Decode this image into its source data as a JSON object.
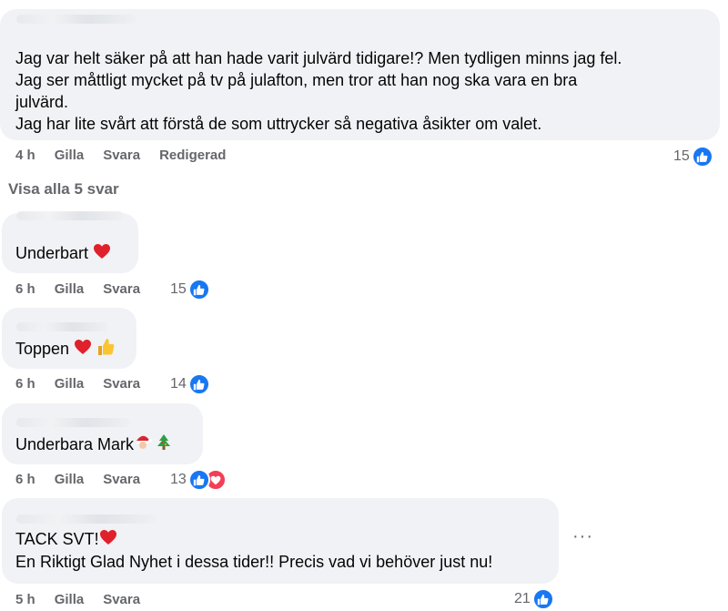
{
  "top_comment": {
    "lines": [
      "Jag var helt säker på att han hade varit julvärd tidigare!? Men tydligen minns jag fel.",
      "Jag ser måttligt mycket på tv på julafton, men tror att han nog ska vara en bra",
      "julvärd.",
      "Jag har lite svårt att förstå de som uttrycker så negativa åsikter om valet."
    ],
    "time": "4 h",
    "like_label": "Gilla",
    "reply_label": "Svara",
    "edited_label": "Redigerad",
    "reaction_count": "15",
    "reaction_icons": [
      "like-icon"
    ]
  },
  "view_all_replies": "Visa alla 5 svar",
  "replies": [
    {
      "text": "Underbart",
      "emojis": [
        "heart-emoji"
      ],
      "time": "6 h",
      "like_label": "Gilla",
      "reply_label": "Svara",
      "reaction_count": "15",
      "reaction_icons": [
        "like-icon"
      ]
    },
    {
      "text": "Toppen",
      "emojis": [
        "heart-emoji",
        "thumbs-up-emoji"
      ],
      "time": "6 h",
      "like_label": "Gilla",
      "reply_label": "Svara",
      "reaction_count": "14",
      "reaction_icons": [
        "like-icon"
      ]
    },
    {
      "text": "Underbara Mark",
      "emojis": [
        "santa-emoji",
        "christmas-tree-emoji"
      ],
      "time": "6 h",
      "like_label": "Gilla",
      "reply_label": "Svara",
      "reaction_count": "13",
      "reaction_icons": [
        "like-icon",
        "love-icon"
      ]
    },
    {
      "line1": "TACK SVT!",
      "line1_emojis": [
        "heart-emoji"
      ],
      "line2": "En Riktigt Glad Nyhet i dessa tider!! Precis vad vi behöver just nu!",
      "time": "5 h",
      "like_label": "Gilla",
      "reply_label": "Svara",
      "reaction_count": "21",
      "reaction_icons": [
        "like-icon"
      ],
      "more_label": "···"
    }
  ],
  "colors": {
    "bubble": "#f0f2f5",
    "meta_text": "#65676b",
    "like_blue": "#1877f2",
    "love_red": "#f33e58"
  }
}
